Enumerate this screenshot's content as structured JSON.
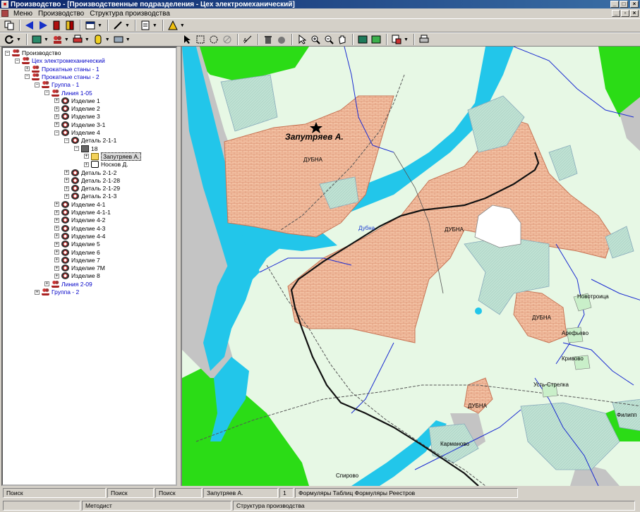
{
  "window": {
    "title": "Производство - [Производственные подразделения - Цех электромеханический]"
  },
  "menu": {
    "items": [
      "Меню",
      "Производство",
      "Структура производства"
    ]
  },
  "tree": {
    "nodes": [
      {
        "label": "Производство",
        "level": 0,
        "icon": "people-icon",
        "expander": "−",
        "color": "black"
      },
      {
        "label": "Цех электромеханический",
        "level": 1,
        "icon": "people-icon",
        "expander": "−",
        "color": "blue"
      },
      {
        "label": "Прокатные станы - 1",
        "level": 2,
        "icon": "people-icon",
        "expander": "+",
        "color": "blue"
      },
      {
        "label": "Прокатные станы - 2",
        "level": 2,
        "icon": "people-icon",
        "expander": "−",
        "color": "blue"
      },
      {
        "label": "Группа - 1",
        "level": 3,
        "icon": "people-icon",
        "expander": "−",
        "color": "blue"
      },
      {
        "label": "Линия 1-05",
        "level": 4,
        "icon": "people-icon",
        "expander": "−",
        "color": "blue"
      },
      {
        "label": "Изделие 1",
        "level": 5,
        "icon": "part-icon",
        "expander": "+",
        "color": "black"
      },
      {
        "label": "Изделие 2",
        "level": 5,
        "icon": "part-icon",
        "expander": "+",
        "color": "black"
      },
      {
        "label": "Изделие 3",
        "level": 5,
        "icon": "part-icon",
        "expander": "+",
        "color": "black"
      },
      {
        "label": "Изделие 3-1",
        "level": 5,
        "icon": "part-icon",
        "expander": "+",
        "color": "black"
      },
      {
        "label": "Изделие 4",
        "level": 5,
        "icon": "part-icon",
        "expander": "−",
        "color": "black"
      },
      {
        "label": "Деталь 2-1-1",
        "level": 6,
        "icon": "part-icon",
        "expander": "−",
        "color": "black"
      },
      {
        "label": "18",
        "level": 7,
        "icon": "house-icon",
        "expander": "−",
        "color": "black"
      },
      {
        "label": "Запутряев А.",
        "level": 8,
        "icon": "folder-icon",
        "expander": "+",
        "color": "black",
        "selected": true
      },
      {
        "label": "Носков Д.",
        "level": 8,
        "icon": "computer-icon",
        "expander": "+",
        "color": "black"
      },
      {
        "label": "Деталь 2-1-2",
        "level": 6,
        "icon": "part-icon",
        "expander": "+",
        "color": "black"
      },
      {
        "label": "Деталь 2-1-28",
        "level": 6,
        "icon": "part-icon",
        "expander": "+",
        "color": "black"
      },
      {
        "label": "Деталь 2-1-29",
        "level": 6,
        "icon": "part-icon",
        "expander": "+",
        "color": "black"
      },
      {
        "label": "Деталь 2-1-3",
        "level": 6,
        "icon": "part-icon",
        "expander": "+",
        "color": "black"
      },
      {
        "label": "Изделие 4-1",
        "level": 5,
        "icon": "part-icon",
        "expander": "+",
        "color": "black"
      },
      {
        "label": "Изделие 4-1-1",
        "level": 5,
        "icon": "part-icon",
        "expander": "+",
        "color": "black"
      },
      {
        "label": "Изделие 4-2",
        "level": 5,
        "icon": "part-icon",
        "expander": "+",
        "color": "black"
      },
      {
        "label": "Изделие 4-3",
        "level": 5,
        "icon": "part-icon",
        "expander": "+",
        "color": "black"
      },
      {
        "label": "Изделие 4-4",
        "level": 5,
        "icon": "part-icon",
        "expander": "+",
        "color": "black"
      },
      {
        "label": "Изделие 5",
        "level": 5,
        "icon": "part-icon",
        "expander": "+",
        "color": "black"
      },
      {
        "label": "Изделие 6",
        "level": 5,
        "icon": "part-icon",
        "expander": "+",
        "color": "black"
      },
      {
        "label": "Изделие 7",
        "level": 5,
        "icon": "part-icon",
        "expander": "+",
        "color": "black"
      },
      {
        "label": "Изделие 7М",
        "level": 5,
        "icon": "part-icon",
        "expander": "+",
        "color": "black"
      },
      {
        "label": "Изделие 8",
        "level": 5,
        "icon": "part-icon",
        "expander": "+",
        "color": "black"
      },
      {
        "label": "Линия 2-09",
        "level": 4,
        "icon": "people-icon",
        "expander": "+",
        "color": "blue"
      },
      {
        "label": "Группа - 2",
        "level": 3,
        "icon": "people-icon",
        "expander": "+",
        "color": "blue"
      }
    ]
  },
  "map": {
    "labels": {
      "person": "Запутряев А.",
      "dubna_1": "ДУБНА",
      "dubna_river": "Дубна",
      "dubna_2": "ДУБНА",
      "dubna_3": "ДУБНА",
      "dubna_4": "ДУБНА",
      "novotroitsa": "Новотроица",
      "arefyevo": "Арефьево",
      "krivovo": "Кривово",
      "ust_strelka": "Усть-Стрелка",
      "filippovo": "Филипп",
      "karmanovo": "Карманово",
      "spirovo": "Спирово"
    },
    "colors": {
      "background": "#e7f8e5",
      "water": "#22c6ea",
      "forest": "#2bdc16",
      "town": "#f2c0a2",
      "town_outline": "#c77455",
      "teal_area": "#bfe1d3",
      "gray_area": "#c4c4c4",
      "road": "#1a2bd1"
    }
  },
  "status": {
    "row1": [
      "Поиск",
      "Поиск",
      "Поиск",
      "Запутряев А.",
      "1",
      "Формуляры Таблиц Формуляры Реестров"
    ],
    "row2": [
      "",
      "Методист",
      "Структура производства"
    ]
  }
}
